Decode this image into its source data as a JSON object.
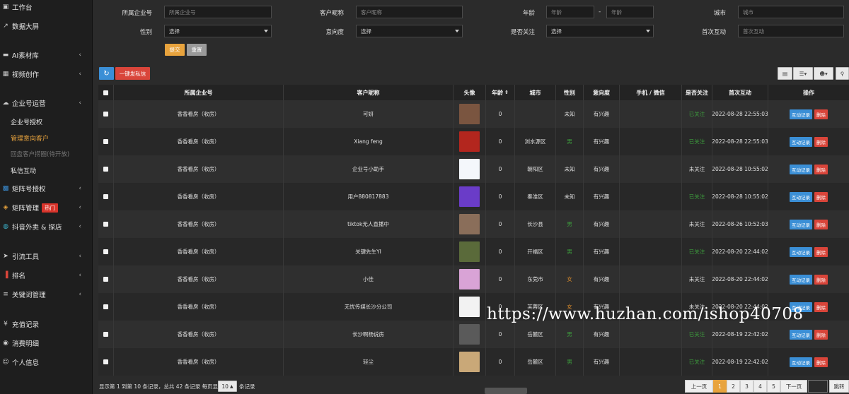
{
  "sidebar": {
    "items": [
      {
        "label": "工作台",
        "icon": "dashboard-icon",
        "arrow": false
      },
      {
        "label": "数据大屏",
        "icon": "chart-line-icon",
        "arrow": false
      },
      {
        "label": "AI素材库",
        "icon": "folder-icon",
        "arrow": true
      },
      {
        "label": "视频创作",
        "icon": "film-icon",
        "arrow": true
      },
      {
        "label": "企业号运营",
        "icon": "cloud-icon",
        "arrow": true
      },
      {
        "label": "企业号授权",
        "sub": true
      },
      {
        "label": "管理意向客户",
        "sub": true,
        "active": true
      },
      {
        "label": "回盘客户捞圈(待开放)",
        "sub": true,
        "dim": true
      },
      {
        "label": "私信互动",
        "sub": true
      },
      {
        "label": "矩阵号授权",
        "icon": "grid-icon",
        "arrow": true
      },
      {
        "label": "矩阵管理",
        "icon": "matrix-icon",
        "arrow": true,
        "badge": "热门"
      },
      {
        "label": "抖音外卖 & 探店",
        "icon": "globe-icon",
        "arrow": true
      },
      {
        "label": "引流工具",
        "icon": "send-icon",
        "arrow": true
      },
      {
        "label": "排名",
        "icon": "bar-chart-icon",
        "arrow": true
      },
      {
        "label": "关键词管理",
        "icon": "document-icon",
        "arrow": true
      },
      {
        "label": "充值记录",
        "icon": "yen-icon",
        "arrow": false
      },
      {
        "label": "消费明细",
        "icon": "eye-icon",
        "arrow": false
      },
      {
        "label": "个人信息",
        "icon": "user-icon",
        "arrow": false
      }
    ]
  },
  "filters": {
    "company": {
      "label": "所属企业号",
      "placeholder": "所属企业号"
    },
    "nickname": {
      "label": "客户昵称",
      "placeholder": "客户昵称"
    },
    "age": {
      "label": "年龄",
      "placeholder_from": "年龄",
      "separator": "-",
      "placeholder_to": "年龄"
    },
    "city": {
      "label": "城市",
      "placeholder": "城市"
    },
    "gender": {
      "label": "性别",
      "value": "选择"
    },
    "intent": {
      "label": "意向度",
      "value": "选择"
    },
    "follow": {
      "label": "是否关注",
      "value": "选择"
    },
    "first_interaction": {
      "label": "首次互动",
      "placeholder": "首次互动"
    },
    "submit_label": "提交",
    "reset_label": "重置"
  },
  "toolbar": {
    "refresh_icon": "refresh-icon",
    "send_dm_label": "一键发私信"
  },
  "table": {
    "columns": [
      "所属企业号",
      "客户昵称",
      "头像",
      "年龄",
      "城市",
      "性别",
      "意向度",
      "手机 / 微信",
      "是否关注",
      "首次互动",
      "操作"
    ],
    "rows": [
      {
        "company": "香香看房（收房）",
        "nickname": "可妍",
        "age": "0",
        "city": "",
        "gender": "未知",
        "gender_color": "normal",
        "intent": "有兴趣",
        "phone": "",
        "follow": "已关注",
        "follow_color": "green",
        "first": "2022-08-28 22:55:03",
        "avatar": "#7a5540"
      },
      {
        "company": "香香看房（收房）",
        "nickname": "Xiang feng",
        "age": "0",
        "city": "浏水源区",
        "gender": "男",
        "gender_color": "green",
        "intent": "有兴趣",
        "phone": "",
        "follow": "已关注",
        "follow_color": "green",
        "first": "2022-08-28 22:55:03",
        "avatar": "#b3261e"
      },
      {
        "company": "香香看房（收房）",
        "nickname": "企业号小助手",
        "age": "0",
        "city": "朝阳区",
        "gender": "未知",
        "gender_color": "normal",
        "intent": "有兴趣",
        "phone": "",
        "follow": "未关注",
        "follow_color": "normal",
        "first": "2022-08-28 10:55:02",
        "avatar": "#f4f7fb"
      },
      {
        "company": "香香看房（收房）",
        "nickname": "用户880817883",
        "age": "0",
        "city": "秦淮区",
        "gender": "未知",
        "gender_color": "normal",
        "intent": "有兴趣",
        "phone": "",
        "follow": "已关注",
        "follow_color": "green",
        "first": "2022-08-28 10:55:02",
        "avatar": "#6a3cc8"
      },
      {
        "company": "香香看房（收房）",
        "nickname": "tiktok无人直播中",
        "age": "0",
        "city": "长沙县",
        "gender": "男",
        "gender_color": "green",
        "intent": "有兴趣",
        "phone": "",
        "follow": "未关注",
        "follow_color": "normal",
        "first": "2022-08-26 10:52:03",
        "avatar": "#8a6e5a"
      },
      {
        "company": "香香看房（收房）",
        "nickname": "关键先生YI",
        "age": "0",
        "city": "开福区",
        "gender": "男",
        "gender_color": "green",
        "intent": "有兴趣",
        "phone": "",
        "follow": "已关注",
        "follow_color": "green",
        "first": "2022-08-20 22:44:02",
        "avatar": "#5a6a3a"
      },
      {
        "company": "香香看房（收房）",
        "nickname": "小佳",
        "age": "0",
        "city": "东莞市",
        "gender": "女",
        "gender_color": "orange",
        "intent": "有兴趣",
        "phone": "",
        "follow": "未关注",
        "follow_color": "normal",
        "first": "2022-08-20 22:44:02",
        "avatar": "#d9a3d6"
      },
      {
        "company": "香香看房（收房）",
        "nickname": "无忧传媒长沙分公司",
        "age": "0",
        "city": "芙蓉区",
        "gender": "女",
        "gender_color": "orange",
        "intent": "有兴趣",
        "phone": "",
        "follow": "未关注",
        "follow_color": "normal",
        "first": "2022-08-20 22:44:02",
        "avatar": "#f2f2f2"
      },
      {
        "company": "香香看房（收房）",
        "nickname": "长沙啊杨说房",
        "age": "0",
        "city": "岳麓区",
        "gender": "男",
        "gender_color": "green",
        "intent": "有兴趣",
        "phone": "",
        "follow": "已关注",
        "follow_color": "green",
        "first": "2022-08-19 22:42:02",
        "avatar": "#5a5a5a"
      },
      {
        "company": "香香看房（收房）",
        "nickname": "轻尘",
        "age": "0",
        "city": "岳麓区",
        "gender": "男",
        "gender_color": "green",
        "intent": "有兴趣",
        "phone": "",
        "follow": "已关注",
        "follow_color": "green",
        "first": "2022-08-19 22:42:02",
        "avatar": "#c9a878"
      }
    ],
    "action_log": "互动记录",
    "action_delete": "删除"
  },
  "footer": {
    "summary": "显示第 1 到第 10 条记录，总共 42 条记录 每页显示",
    "per_page": "10",
    "per_page_suffix": "条记录",
    "prev": "上一页",
    "pages": [
      "1",
      "2",
      "3",
      "4",
      "5"
    ],
    "next": "下一页",
    "jump": "跳转"
  },
  "watermark": "https://www.huzhan.com/ishop40708",
  "colors": {
    "accent": "#e8a33d",
    "primary": "#3b8fd6",
    "danger": "#d9453a",
    "success": "#3d9f3d"
  }
}
